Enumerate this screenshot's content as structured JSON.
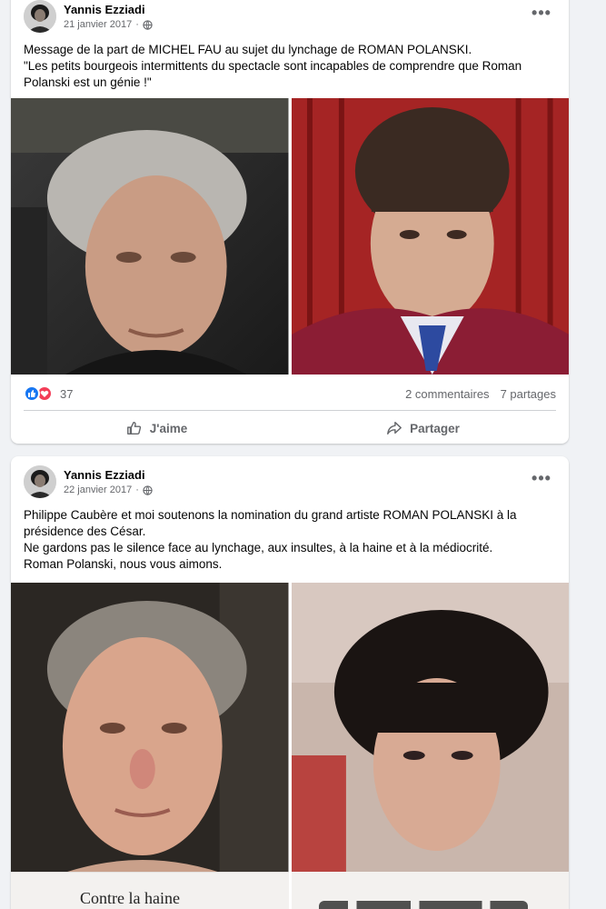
{
  "posts": [
    {
      "author": "Yannis Ezziadi",
      "date": "21 janvier 2017",
      "separator": "·",
      "privacy_icon": "globe-icon",
      "more_icon": "more-options-icon",
      "text_lines": [
        "Message de la part de MICHEL FAU au sujet du lynchage de ROMAN POLANSKI.",
        "\"Les petits bourgeois intermittents du spectacle sont incapables de comprendre que Roman",
        "Polanski est un génie !\""
      ],
      "reactions": {
        "icons": [
          "like-reaction-icon",
          "love-reaction-icon"
        ],
        "count": "37"
      },
      "comments": "2 commentaires",
      "shares": "7 partages",
      "actions": {
        "like": "J'aime",
        "share": "Partager"
      }
    },
    {
      "author": "Yannis Ezziadi",
      "date": "22 janvier 2017",
      "separator": "·",
      "privacy_icon": "globe-icon",
      "more_icon": "more-options-icon",
      "text_lines": [
        "Philippe Caubère et moi soutenons la nomination du grand artiste ROMAN POLANSKI à la",
        "présidence des César.",
        "Ne gardons pas le silence face au lynchage, aux insultes, à la haine et à la médiocrité.",
        "Roman Polanski, nous vous aimons."
      ],
      "photo_caption": "Contre la haine"
    }
  ],
  "colors": {
    "background": "#f0f2f5",
    "card": "#ffffff",
    "text": "#050505",
    "secondary_text": "#65676b",
    "like_blue": "#1877f2",
    "love_red": "#f33e58"
  }
}
